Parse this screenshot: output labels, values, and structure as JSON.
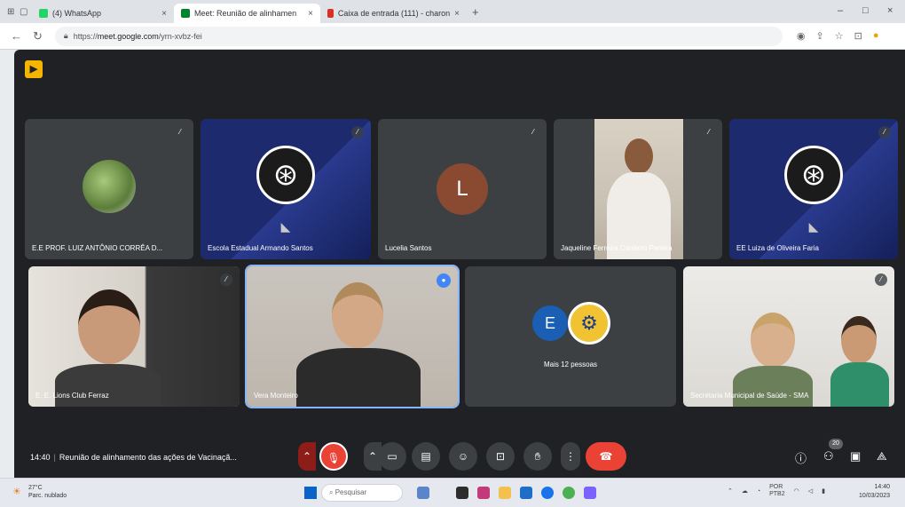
{
  "browser": {
    "tabs": [
      {
        "label": "(4) WhatsApp",
        "active": false
      },
      {
        "label": "Meet: Reunião de alinhamen",
        "active": true
      },
      {
        "label": "Caixa de entrada (111) - charon",
        "active": false
      }
    ],
    "new_tab": "+",
    "url_prefix": "https://",
    "url_host": "meet.google.com",
    "url_path": "/yrn-xvbz-fei",
    "window_controls": [
      "–",
      "□",
      "×"
    ]
  },
  "participants": [
    {
      "name": "E.E PROF. LUIZ ANTÔNIO CORRÊA D...",
      "kind": "photo-avatar"
    },
    {
      "name": "Escola Estadual Armando Santos",
      "kind": "obs"
    },
    {
      "name": "Lucelia Santos",
      "kind": "letter",
      "initial": "L",
      "color": "#8a4a32"
    },
    {
      "name": "Jaqueline Ferreira Cordeiro Pereira",
      "kind": "video"
    },
    {
      "name": "EE Luiza de Oliveira Faria",
      "kind": "obs"
    },
    {
      "name": "E. E. Lions Club Ferraz",
      "kind": "video"
    },
    {
      "name": "Vera Monteiro",
      "kind": "video",
      "speaking": true
    },
    {
      "name": "Mais 12 pessoas",
      "kind": "more",
      "initial": "E"
    },
    {
      "name": "Secretaria Municipal de Saúde - SMA",
      "kind": "video"
    }
  ],
  "meeting": {
    "time": "14:40",
    "separator": "|",
    "title": "Reunião de alinhamento das ações de Vacinaçã...",
    "people_count": "20"
  },
  "taskbar": {
    "weather_temp": "27°C",
    "weather_desc": "Parc. nublado",
    "search_placeholder": "Pesquisar",
    "lang": "POR",
    "lang2": "PTB2",
    "time": "14:40",
    "date": "10/03/2023"
  },
  "colors": {
    "meet_bg": "#202124",
    "tile_bg": "#3c4043",
    "end_call": "#ea4335",
    "speaking_outline": "#8ab4f8"
  }
}
